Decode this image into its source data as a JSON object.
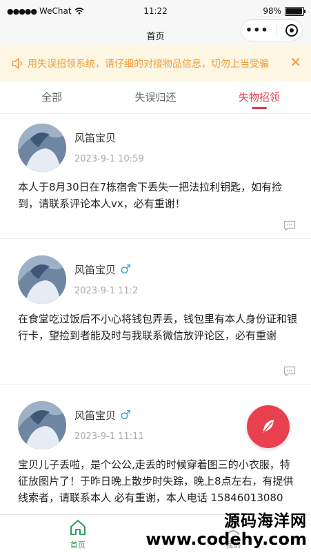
{
  "status_bar": {
    "carrier": "WeChat",
    "time": "11:22",
    "battery": "98%"
  },
  "nav": {
    "title": "首页",
    "more_icon": "more-dots-icon",
    "close_icon": "target-icon"
  },
  "notice": {
    "icon": "speaker-icon",
    "text": "用失误招领系统，请仔细的对接物品信息，切勿上当受骗",
    "close": "✕"
  },
  "tabs": [
    {
      "label": "全部",
      "active": false
    },
    {
      "label": "失误归还",
      "active": false
    },
    {
      "label": "失物招领",
      "active": true
    }
  ],
  "posts": [
    {
      "username": "风笛宝贝",
      "gender": "",
      "time": "2023-9-1 10:59",
      "content": "本人于8月30日在7栋宿舍下丢失一把法拉利钥匙，如有捡到，请联系评论本人vx，必有重谢！"
    },
    {
      "username": "风笛宝贝",
      "gender": "♂",
      "time": "2023-9-1 11:2",
      "content": "在食堂吃过饭后不小心将钱包弄丢，钱包里有本人身份证和银行卡，望捡到者能及时与我联系微信放评论区，必有重谢"
    },
    {
      "username": "风笛宝贝",
      "gender": "♂",
      "time": "2023-9-1 11:11",
      "content": "宝贝儿子丢啦，是个公公,走丢的时候穿着图三的小衣服，特征放图片了！于昨日晚上散步时失踪，晚上8点左右，有提供线索者，请联系本人 必有重谢，本人电话 15846013080"
    }
  ],
  "fab": {
    "icon": "feather-icon"
  },
  "tabbar": [
    {
      "label": "首页",
      "icon": "home-icon",
      "active": true
    },
    {
      "label": "我的",
      "icon": "user-icon",
      "active": false
    }
  ],
  "watermark": {
    "cn": "源码海洋网",
    "url": "www.codehy.com"
  },
  "colors": {
    "accent": "#e03a4d",
    "notice_text": "#ef9c3b",
    "notice_bg": "#fcf6e2",
    "gender_male": "#3aa8e6",
    "tab_active": "#2f9c5a"
  }
}
